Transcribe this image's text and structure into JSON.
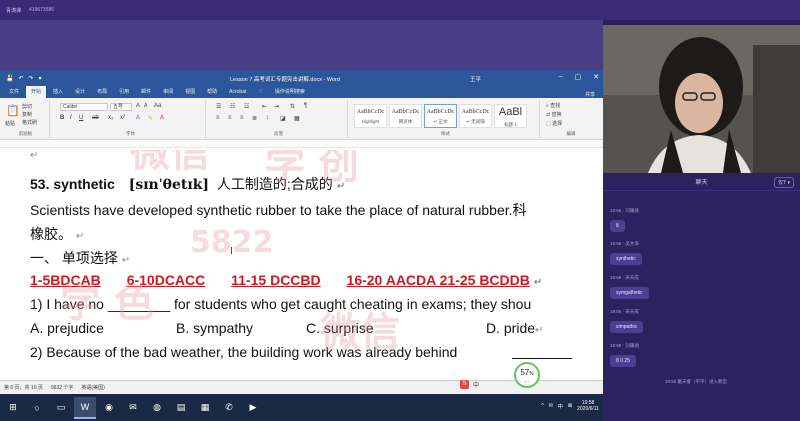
{
  "topbar": {
    "app": "青涛课",
    "room_id": "419673586"
  },
  "word": {
    "title": "Lesson 7 高考词汇专题突击讲解.docx - Word",
    "user": "王平",
    "quick_access": [
      "💾",
      "↶",
      "↷",
      "▾"
    ],
    "tabs": [
      "文件",
      "开始",
      "插入",
      "设计",
      "布局",
      "引用",
      "邮件",
      "审阅",
      "视图",
      "帮助",
      "Acrobat",
      "♡",
      "操作说明搜索"
    ],
    "share": "共享",
    "ribbon": {
      "clipboard": {
        "paste": "粘贴",
        "cut": "剪切",
        "copy": "复制",
        "format_painter": "格式刷",
        "label": "剪贴板"
      },
      "font": {
        "name": "Calibri",
        "size": "五号",
        "label": "字体"
      },
      "paragraph": {
        "label": "段落"
      },
      "styles": {
        "label": "样式",
        "items": [
          {
            "sample": "AaBbCcDc",
            "name": "Highlight"
          },
          {
            "sample": "AaBbCcDc",
            "name": "网页体"
          },
          {
            "sample": "AaBbCcDc",
            "name": "↵ 正文"
          },
          {
            "sample": "AaBbCcDc",
            "name": "↵ 无间隔"
          },
          {
            "sample": "AaBl",
            "name": "标题 1"
          }
        ]
      },
      "editing": {
        "find": "查找",
        "replace": "替换",
        "select": "选择",
        "label": "编辑"
      }
    },
    "document": {
      "word_line": {
        "word": "53. synthetic",
        "ipa": "[sɪnˈθetɪk]",
        "meaning": "人工制造的;合成的"
      },
      "sentence": "Scientists have developed synthetic rubber to take the place of natural rubber.科",
      "sentence_cont": "橡胶。",
      "section": "一、  单项选择",
      "cursor_glyph": "I",
      "answers": [
        "1-5BDCAB",
        "6-10DCACC",
        "11-15 DCCBD",
        "16-20 AACDA 21-25 BCDDB"
      ],
      "q1": "1) I have no ________ for students who get caught cheating in exams; they shou",
      "options": [
        "A. prejudice",
        "B. sympathy",
        "C. surprise",
        "D. pride"
      ],
      "q2": "2) Because of the bad weather, the building work was already behind",
      "watermarks": [
        "微信",
        "学  创",
        "5822",
        "学  色",
        "微信",
        "学 色"
      ]
    },
    "status": {
      "page": "第 6 页，共 10 页",
      "words": "9832 个字",
      "lang": "英语(美国)"
    }
  },
  "speed": {
    "value": "57",
    "unit": "%",
    "sub": "3 ↑"
  },
  "overlay_badges": [
    "S",
    "中"
  ],
  "taskbar": {
    "items": [
      "⊞",
      "○",
      "▭",
      "W",
      "◉",
      "✉",
      "◍",
      "▤",
      "▦",
      "✆",
      "▶"
    ],
    "tray": [
      "^",
      "✉",
      "中",
      "⊠"
    ],
    "time": "19:58",
    "date": "2020/6/11"
  },
  "chat": {
    "title": "聊天",
    "filter": "仅T ▾",
    "messages": [
      {
        "time": "19:56",
        "name": "刘珊涵",
        "text": "8"
      },
      {
        "time": "19:56",
        "name": "吴文泽",
        "text": "synthetic"
      },
      {
        "time": "19:56",
        "name": "宋天成",
        "text": "symgathetic"
      },
      {
        "time": "19:56",
        "name": "宋天成",
        "text": "simpathic"
      },
      {
        "time": "19:58",
        "name": "刘珊涵",
        "text": "8 0 25"
      }
    ],
    "join_notice": "19:59  戴天睿（平平）进入教室"
  }
}
